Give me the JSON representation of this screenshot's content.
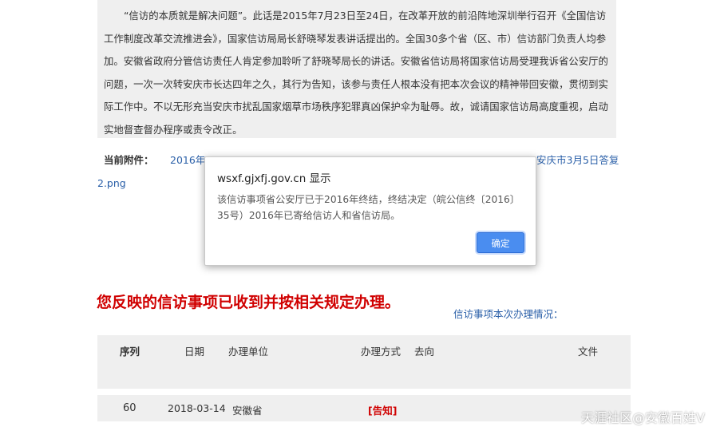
{
  "content": {
    "paragraph": "“信访的本质就是解决问题”。此话是2015年7月23日至24日，在改革开放的前沿阵地深圳举行召开《全国信访工作制度改革交流推进会》，国家信访局局长舒晓琴发表讲话提出的。全国30多个省（区、市）信访部门负责人均参加。安徽省政府分管信访责任人肯定参加聆听了舒晓琴局长的讲话。安徽省信访局将国家信访局受理我诉省公安厅的问题，一次一次转安庆市长达四年之久，其行为告知，该参与责任人根本没有把本次会议的精神带回安徽，贯彻到实际工作中。不以无形充当安庆市扰乱国家烟草市场秩序犯罪真凶保护伞为耻辱。故，诚请国家信访局高度重视，启动实地督查督办程序或责令改正。"
  },
  "attachments": {
    "label": "当前附件：",
    "link_start": "2016年",
    "link_end": "安庆市3月5日答复",
    "link_wrap": "2.png"
  },
  "headline": "您反映的信访事项已收到并按相关规定办理。",
  "status_link": "信访事项本次办理情况：",
  "table": {
    "headers": {
      "seq": "序列",
      "date": "日期",
      "unit": "办理单位",
      "method": "办理方式",
      "direction": "去向",
      "file": "文件"
    },
    "rows": [
      {
        "seq": "60",
        "date": "2018-03-14",
        "unit": "安徽省",
        "method": "[告知]"
      }
    ]
  },
  "dialog": {
    "title": "wsxf.gjxfj.gov.cn 显示",
    "message": "该信访事项省公安厅已于2016年终结，终结决定（皖公信终〔2016〕35号）2016年已寄给信访人和省信访局。",
    "ok_label": "确定"
  },
  "watermark": "天涯社区@安徽百姓V"
}
